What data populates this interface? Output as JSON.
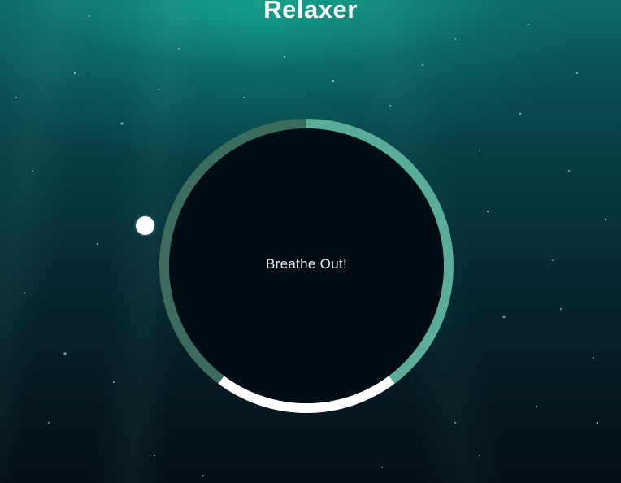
{
  "app": {
    "title": "Relaxer"
  },
  "breather": {
    "phase_text": "Breathe Out!",
    "segments": [
      {
        "name": "breathe-in",
        "color": "#5aae99"
      },
      {
        "name": "hold",
        "color": "#ffffff"
      },
      {
        "name": "breathe-out",
        "color": "#3b6c5e"
      }
    ]
  },
  "colors": {
    "core": "#020c15",
    "pointer": "#ffffff",
    "text": "#ffffff"
  }
}
